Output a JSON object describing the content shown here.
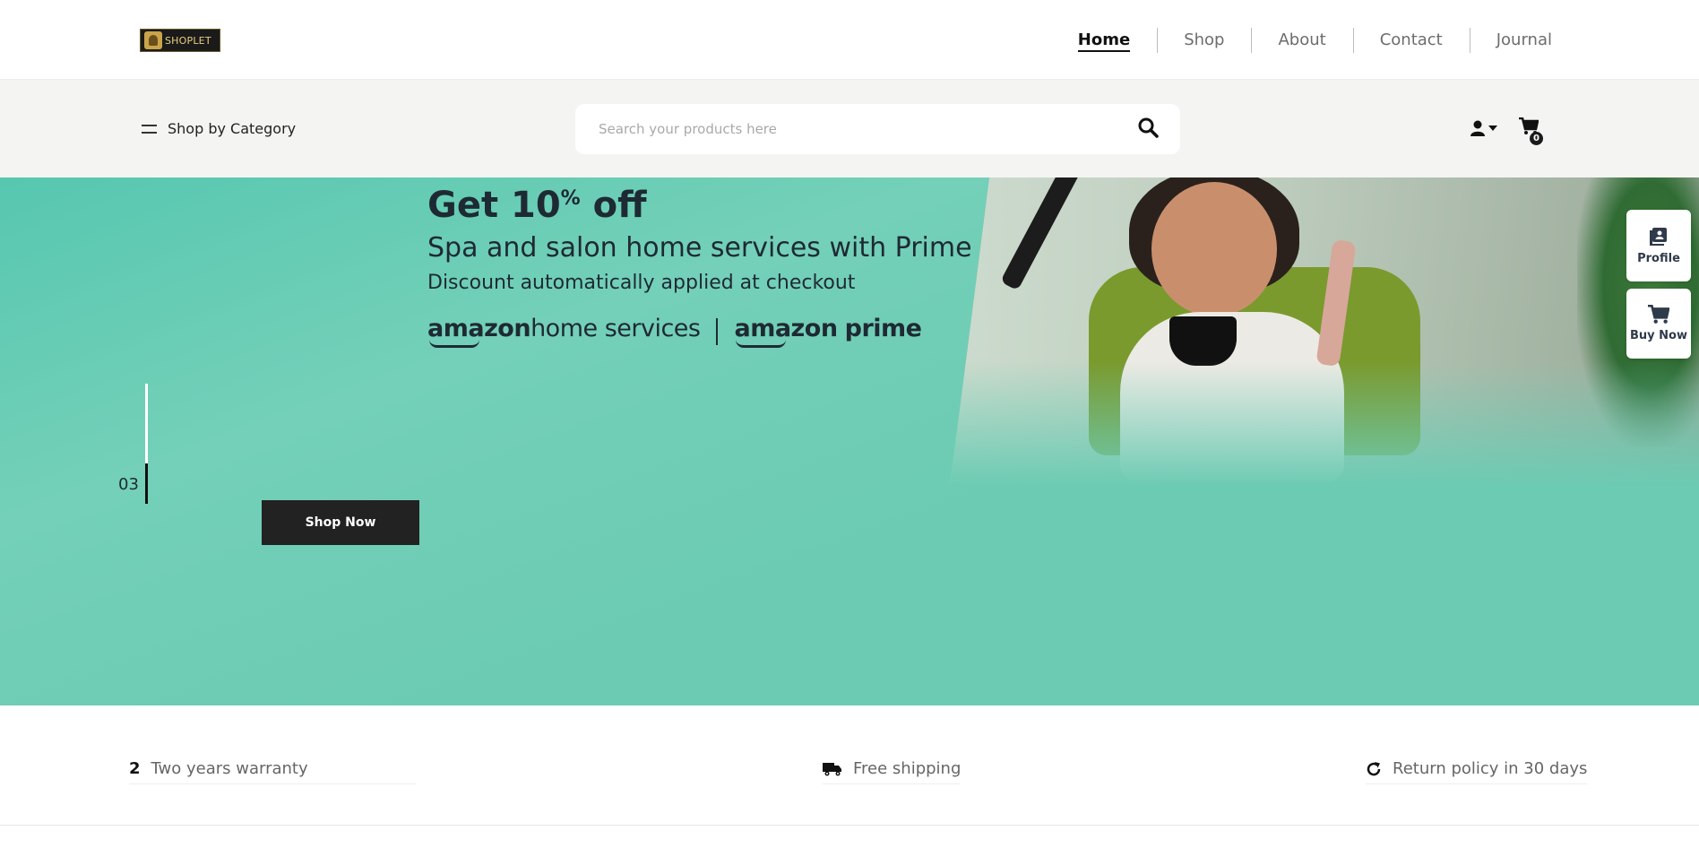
{
  "brand": {
    "logo_text": "SHOPLET"
  },
  "nav": {
    "items": [
      {
        "label": "Home",
        "active": true
      },
      {
        "label": "Shop",
        "active": false
      },
      {
        "label": "About",
        "active": false
      },
      {
        "label": "Contact",
        "active": false
      },
      {
        "label": "Journal",
        "active": false
      }
    ]
  },
  "subbar": {
    "category_label": "Shop by Category",
    "search_placeholder": "Search your products here",
    "search_value": "",
    "cart_count": "0"
  },
  "hero": {
    "promo_title_main": "Get 10",
    "promo_title_sup": "%",
    "promo_title_end": " off",
    "promo_subtitle": "Spa and salon home services with Prime",
    "promo_note": "Discount automatically applied at checkout",
    "brand_left_a": "amazon",
    "brand_left_b": "home services",
    "brand_right_a": "amazon",
    "brand_right_b": "prime",
    "slide_number": "03",
    "cta_label": "Shop Now"
  },
  "side_buttons": {
    "profile_label": "Profile",
    "buy_label": "Buy Now"
  },
  "features": {
    "warranty_number": "2",
    "warranty_label": "Two years warranty",
    "shipping_label": "Free shipping",
    "return_label": "Return policy in 30 days"
  },
  "colors": {
    "hero_bg": "#6ccbb3",
    "cta_bg": "#222222",
    "subbar_bg": "#f4f4f2"
  }
}
